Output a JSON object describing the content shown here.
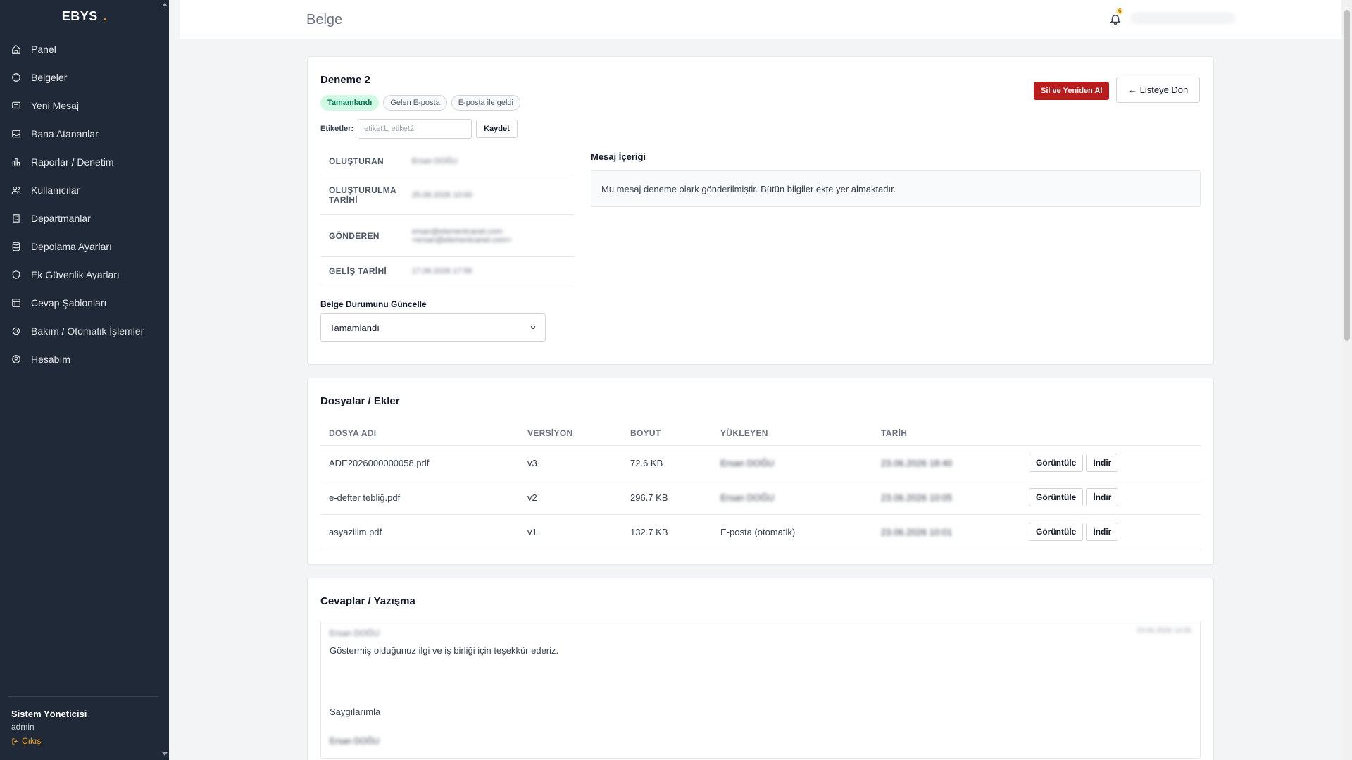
{
  "sidebar": {
    "brand": "EBYS",
    "brand_dot": ".",
    "items": [
      {
        "label": "Panel",
        "icon": "home-icon"
      },
      {
        "label": "Belgeler",
        "icon": "documents-icon"
      },
      {
        "label": "Yeni Mesaj",
        "icon": "message-icon"
      },
      {
        "label": "Bana Atananlar",
        "icon": "inbox-icon"
      },
      {
        "label": "Raporlar / Denetim",
        "icon": "chart-icon"
      },
      {
        "label": "Kullanıcılar",
        "icon": "users-icon"
      },
      {
        "label": "Departmanlar",
        "icon": "building-icon"
      },
      {
        "label": "Depolama Ayarları",
        "icon": "database-icon"
      },
      {
        "label": "Ek Güvenlik Ayarları",
        "icon": "shield-icon"
      },
      {
        "label": "Cevap Şablonları",
        "icon": "template-icon"
      },
      {
        "label": "Bakım / Otomatik İşlemler",
        "icon": "gear-icon"
      },
      {
        "label": "Hesabım",
        "icon": "user-circle-icon"
      }
    ],
    "user": {
      "name": "Sistem Yöneticisi",
      "role": "admin",
      "logout": "Çıkış"
    }
  },
  "header": {
    "title": "Belge",
    "notification_count": "6"
  },
  "document": {
    "title": "Deneme 2",
    "badges": [
      "Tamamlandı",
      "Gelen E-posta",
      "E-posta ile geldi"
    ],
    "delete_button": "Sil ve Yeniden Al",
    "back_button": "← Listeye Dön",
    "tags_label": "Etiketler:",
    "tags_placeholder": "etiket1, etiket2",
    "save_button": "Kaydet",
    "meta": [
      {
        "key": "OLUŞTURAN",
        "value": "Ersan DOĞU"
      },
      {
        "key": "OLUŞTURULMA TARİHİ",
        "value": "25.06.2026 10:00"
      },
      {
        "key": "GÖNDEREN",
        "value": "ersan@elementcanet.com",
        "value2": "<ersan@elementcanet.com>"
      },
      {
        "key": "GELİŞ TARİHİ",
        "value": "17.06.2026 17:56"
      }
    ],
    "status_label": "Belge Durumunu Güncelle",
    "status_value": "Tamamlandı",
    "message_label": "Mesaj İçeriği",
    "message_text": "Mu mesaj deneme olark gönderilmiştir. Bütün bilgiler ekte yer almaktadır."
  },
  "files": {
    "title": "Dosyalar / Ekler",
    "headers": [
      "DOSYA ADI",
      "VERSİYON",
      "BOYUT",
      "YÜKLEYEN",
      "TARİH"
    ],
    "rows": [
      {
        "name": "ADE2026000000058.pdf",
        "version": "v3",
        "size": "72.6 KB",
        "uploader": "Ersan DOĞU",
        "date": "23.06.2026 18:40"
      },
      {
        "name": "e-defter tebliğ.pdf",
        "version": "v2",
        "size": "296.7 KB",
        "uploader": "Ersan DOĞU",
        "date": "23.06.2026 10:05"
      },
      {
        "name": "asyazilim.pdf",
        "version": "v1",
        "size": "132.7 KB",
        "uploader": "E-posta (otomatik)",
        "date": "23.06.2026 10:01"
      }
    ],
    "view_button": "Görüntüle",
    "download_button": "İndir"
  },
  "replies": {
    "title": "Cevaplar / Yazışma",
    "author": "Ersan DOĞU",
    "date": "23.06.2026 14:05",
    "line1": "Göstermiş olduğunuz ilgi ve iş birliği için teşekkür ederiz.",
    "line2": "Saygılarımla",
    "signature": "Ersan DOĞU"
  }
}
